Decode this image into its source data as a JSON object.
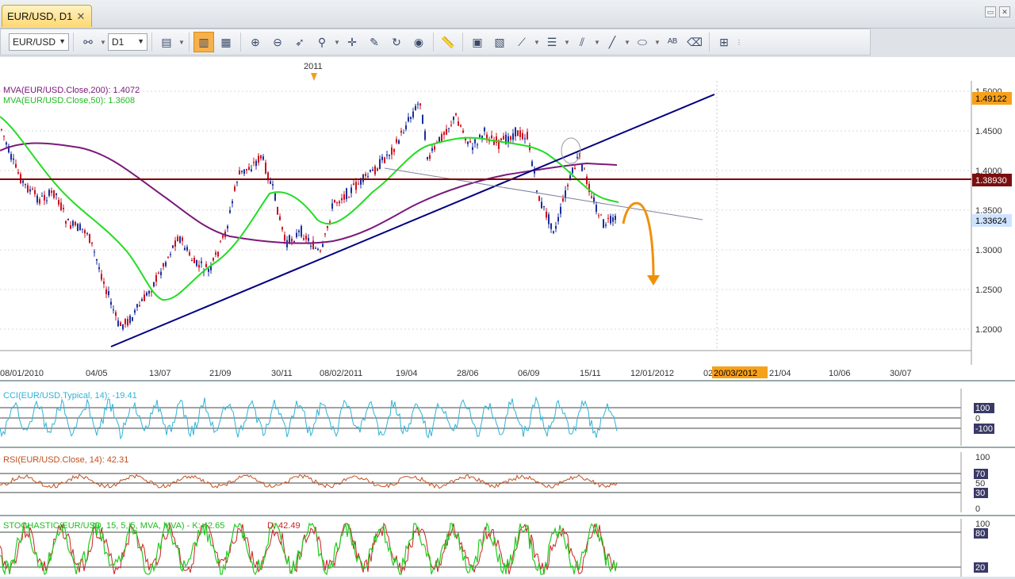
{
  "tab": {
    "title": "EUR/USD, D1",
    "close": "✕"
  },
  "window_buttons": [
    "▭",
    "✕"
  ],
  "toolbar": {
    "symbol": "EUR/USD",
    "timeframe": "D1"
  },
  "colors": {
    "ma200": "#7b1a7b",
    "ma50": "#00cc00",
    "trendline": "#000080",
    "resistance": "#800000",
    "arrow": "#f0900a",
    "cci": "#2fb3d6",
    "rsi": "#c0501e",
    "stoch_k": "#22cc22",
    "stoch_d": "#cc2222",
    "price_tag_orange": "#f7a11a",
    "price_tag_dark": "#7a0f0f",
    "price_tag_blue": "#cfe3ff"
  },
  "main_chart": {
    "year_marker": "2011",
    "ma200_label": "MVA(EUR/USD.Close,200): 1.4072",
    "ma50_label": "MVA(EUR/USD.Close,50): 1.3608",
    "y_ticks": [
      "1.5000",
      "1.4500",
      "1.4000",
      "1.3500",
      "1.3000",
      "1.2500",
      "1.2000"
    ],
    "price_tags": [
      "1.49122",
      "1.38930",
      "1.33624"
    ],
    "x_labels": [
      "08/01/2010",
      "04/05",
      "13/07",
      "21/09",
      "30/11",
      "08/02/2011",
      "19/04",
      "28/06",
      "06/09",
      "15/11",
      "12/01/2012",
      "02",
      "20/03/2012",
      "21/04",
      "10/06",
      "30/07"
    ]
  },
  "cci_panel": {
    "label": "CCI(EUR/USD.Typical, 14): -19.41",
    "levels": [
      "100",
      "0",
      "-100"
    ]
  },
  "rsi_panel": {
    "label": "RSI(EUR/USD.Close, 14): 42.31",
    "levels": [
      "100",
      "70",
      "50",
      "30",
      "0"
    ]
  },
  "stoch_panel": {
    "label_k": "STOCHASTIC(EUR/USD, 15, 5, 5, MVA, MVA) - K: 42.65",
    "label_d": "D: 42.49",
    "levels": [
      "100",
      "80",
      "20"
    ]
  }
}
